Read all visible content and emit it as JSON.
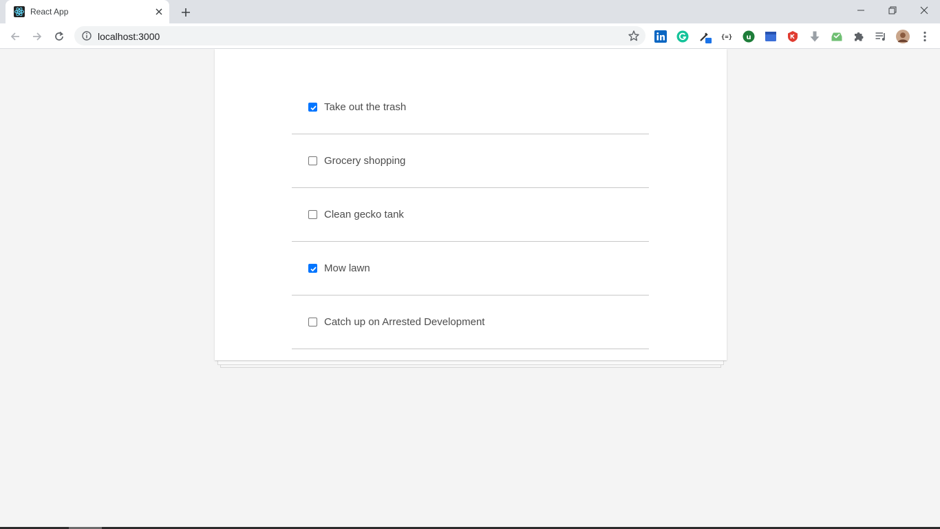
{
  "browser": {
    "tab_title": "React App",
    "url": "localhost:3000",
    "extensions": [
      "linkedin-icon",
      "grammarly-icon",
      "eyedropper-icon",
      "json-viewer-icon",
      "ublock-icon",
      "window-icon",
      "shield-icon",
      "download-icon",
      "inbox-icon",
      "puzzle-icon",
      "media-queue-icon"
    ]
  },
  "todos": [
    {
      "label": "Take out the trash",
      "completed": true
    },
    {
      "label": "Grocery shopping",
      "completed": false
    },
    {
      "label": "Clean gecko tank",
      "completed": false
    },
    {
      "label": "Mow lawn",
      "completed": true
    },
    {
      "label": "Catch up on Arrested Development",
      "completed": false
    }
  ],
  "colors": {
    "accent": "#0075ff",
    "page_background": "#f4f4f4"
  }
}
